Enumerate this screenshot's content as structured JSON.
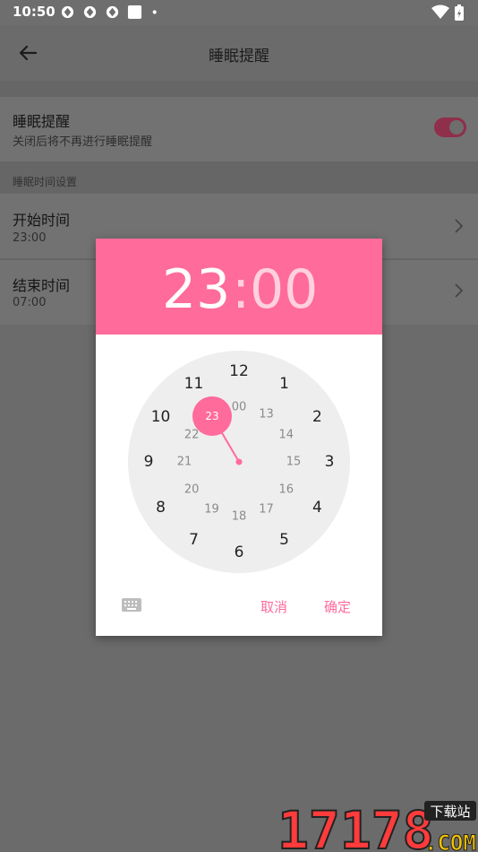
{
  "status_bar": {
    "time": "10:50",
    "icons": [
      "sync-icon",
      "sync-icon",
      "sync-icon",
      "app-icon",
      "dot-icon"
    ],
    "right_icons": [
      "wifi-icon",
      "battery-icon"
    ]
  },
  "app_bar": {
    "title": "睡眠提醒",
    "back_icon": "arrow-left-icon"
  },
  "settings": {
    "reminder": {
      "title": "睡眠提醒",
      "subtitle": "关闭后将不再进行睡眠提醒",
      "enabled": true
    },
    "group_header": "睡眠时间设置",
    "start": {
      "title": "开始时间",
      "value": "23:00"
    },
    "end": {
      "title": "结束时间",
      "value": "07:00"
    }
  },
  "dialog": {
    "hour": "23",
    "colon": ":",
    "minute": "00",
    "outer_numbers": [
      "12",
      "1",
      "2",
      "3",
      "4",
      "5",
      "6",
      "7",
      "8",
      "9",
      "10",
      "11"
    ],
    "inner_numbers": [
      "00",
      "13",
      "14",
      "15",
      "16",
      "17",
      "18",
      "19",
      "20",
      "21",
      "22",
      "23"
    ],
    "selected": "23",
    "cancel": "取消",
    "ok": "确定",
    "keyboard_icon": "keyboard-icon"
  },
  "colors": {
    "accent": "#ff6b9b",
    "toggle_on": "#8f2f4b"
  },
  "watermark": {
    "number": "17178",
    "tag": "下载站",
    "domain": ".COM"
  }
}
